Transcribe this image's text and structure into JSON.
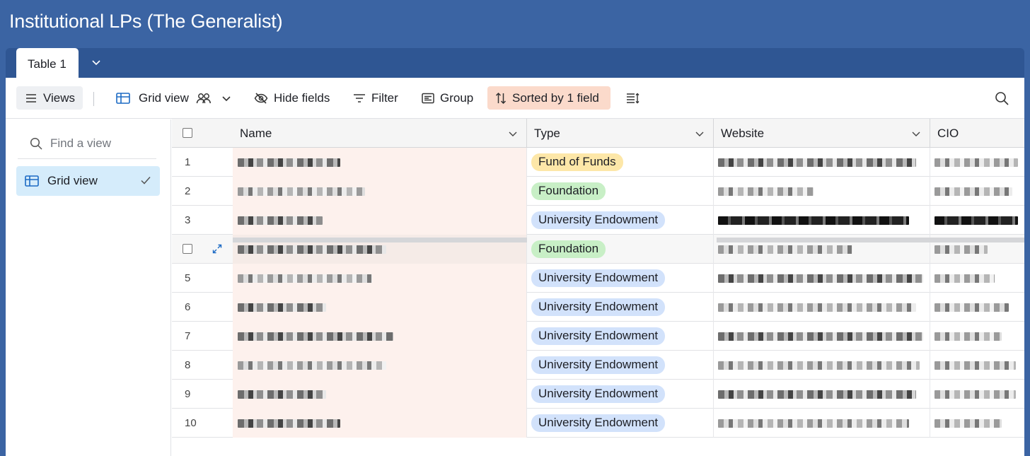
{
  "app": {
    "title": "Institutional LPs (The Generalist)"
  },
  "tabs": [
    {
      "label": "Table 1",
      "active": true
    }
  ],
  "toolbar": {
    "views_label": "Views",
    "grid_view_label": "Grid view",
    "hide_fields_label": "Hide fields",
    "filter_label": "Filter",
    "group_label": "Group",
    "sort_label": "Sorted by 1 field"
  },
  "sidebar": {
    "search_placeholder": "Find a view",
    "views": [
      {
        "label": "Grid view",
        "selected": true
      }
    ]
  },
  "grid": {
    "columns": [
      {
        "label": "Name"
      },
      {
        "label": "Type"
      },
      {
        "label": "Website"
      },
      {
        "label": "CIO"
      }
    ],
    "rows": [
      {
        "num": "1",
        "type": "Fund of Funds"
      },
      {
        "num": "2",
        "type": "Foundation"
      },
      {
        "num": "3",
        "type": "University Endowment"
      },
      {
        "num": "",
        "type": "Foundation"
      },
      {
        "num": "5",
        "type": "University Endowment"
      },
      {
        "num": "6",
        "type": "University Endowment"
      },
      {
        "num": "7",
        "type": "University Endowment"
      },
      {
        "num": "8",
        "type": "University Endowment"
      },
      {
        "num": "9",
        "type": "University Endowment"
      },
      {
        "num": "10",
        "type": "University Endowment"
      }
    ]
  },
  "colors": {
    "brand_blue": "#3b64a3",
    "fund_of_funds": "#fde7a8",
    "foundation": "#c8efc6",
    "university_endowment": "#d2e2fb",
    "sorted_bg": "#fbdacb"
  },
  "icons": [
    "chevron-down-icon",
    "menu-icon",
    "grid-icon",
    "people-icon",
    "eye-slash-icon",
    "filter-icon",
    "group-icon",
    "sort-icon",
    "row-height-icon",
    "search-icon",
    "check-icon",
    "expand-icon"
  ]
}
